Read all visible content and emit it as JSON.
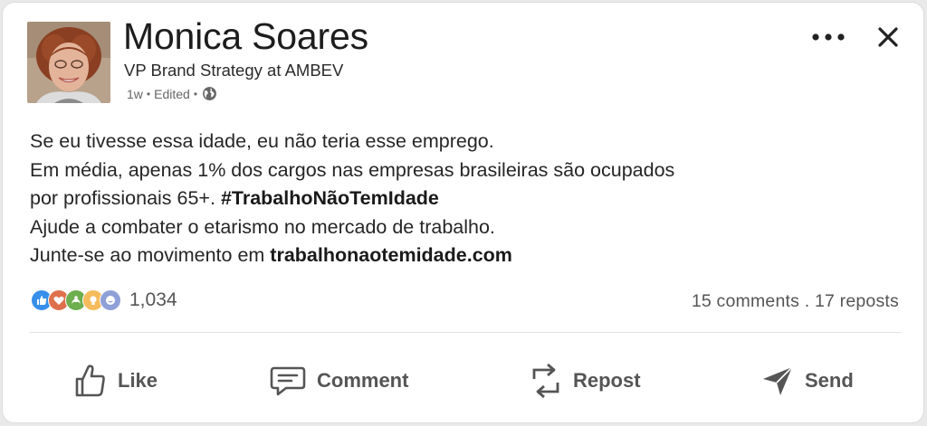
{
  "post": {
    "author_name": "Monica Soares",
    "author_headline": "VP Brand Strategy at AMBEV",
    "time": "1w",
    "sep": "•",
    "edited": "Edited",
    "body": {
      "line1": "Se eu tivesse essa idade, eu não teria esse emprego.",
      "line2": "Em média, apenas 1% dos cargos nas empresas brasileiras são ocupados",
      "line3_text": "por profissionais 65+. ",
      "line3_hashtag": "#TrabalhoNãoTemIdade",
      "line4": "Ajude a combater o etarismo no mercado de trabalho.",
      "line5_text": "Junte-se ao movimento em ",
      "line5_link": "trabalhonaotemidade.com"
    },
    "reactions": {
      "count": "1,034",
      "icons": [
        "like-icon",
        "love-icon",
        "support-icon",
        "insightful-icon",
        "funny-icon"
      ]
    },
    "stats": "15 comments . 17 reposts"
  },
  "actions": {
    "like": "Like",
    "comment": "Comment",
    "repost": "Repost",
    "send": "Send"
  },
  "colors": {
    "like": "#378fe9",
    "love": "#df704d",
    "support": "#6dae4f",
    "insightful": "#f5bb5c",
    "funny": "#8fa0d8"
  }
}
